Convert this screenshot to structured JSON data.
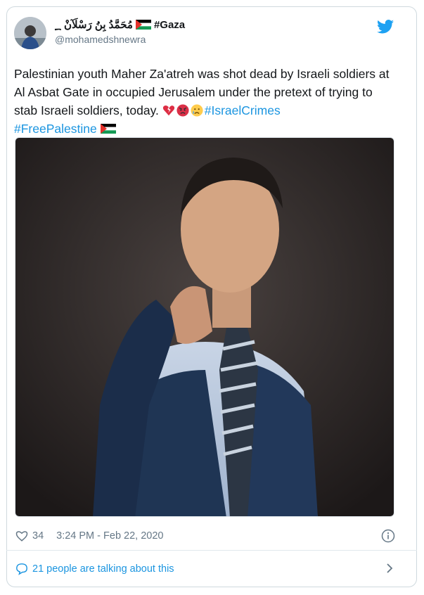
{
  "tweet": {
    "display_name_arabic": "مُحَمَّدُ بِنُ رَسْلَآنْ ؁",
    "display_name_hashtag": "#Gaza",
    "handle": "@mohamedshnewra",
    "text_1": "Palestinian youth Maher Za'atreh was shot dead by Israeli soldiers at Al Asbat Gate in occupied Jerusalem under the pretext of trying to stab Israeli soldiers, today. ",
    "hashtag_1": "#IsraelCrimes",
    "hashtag_2": "#FreePalestine",
    "likes": "34",
    "timestamp": "3:24 PM - Feb 22, 2020",
    "talking": "21 people are talking about this"
  },
  "icons": {
    "bird": "twitter-bird-icon",
    "flag": "palestine-flag-icon",
    "heart": "heart-outline-icon",
    "info": "info-icon",
    "bubble": "speech-bubble-icon",
    "chevron": "chevron-right-icon",
    "emojis": [
      "broken-heart-icon",
      "angry-face-icon",
      "crying-face-icon"
    ]
  },
  "colors": {
    "link": "#1b95e0",
    "muted": "#657786",
    "text": "#14171a",
    "border": "#cfd9de"
  }
}
